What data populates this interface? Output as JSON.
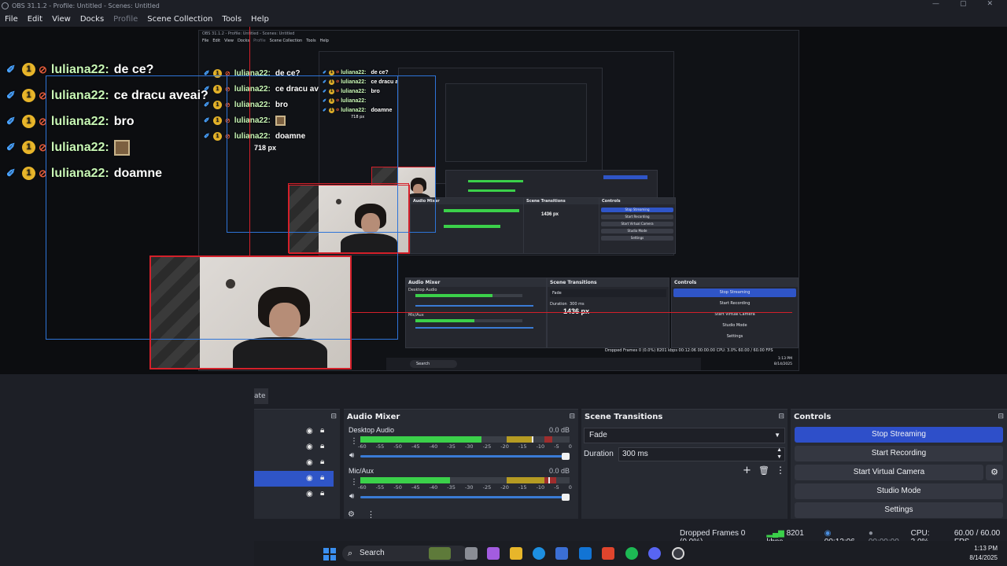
{
  "window": {
    "title": "OBS 31.1.2 - Profile: Untitled - Scenes: Untitled",
    "controls": [
      "—",
      "▢",
      "✕"
    ]
  },
  "menu": [
    "File",
    "Edit",
    "View",
    "Docks",
    "Profile",
    "Scene Collection",
    "Tools",
    "Help"
  ],
  "chat": [
    {
      "user": "luliana22:",
      "message": "de ce?"
    },
    {
      "user": "luliana22:",
      "message": "ce dracu aveai?"
    },
    {
      "user": "luliana22:",
      "message": "bro"
    },
    {
      "user": "luliana22:",
      "message": ""
    },
    {
      "user": "luliana22:",
      "message": "doamne"
    }
  ],
  "preview": {
    "label_height": "718 px",
    "label_width": "1436 px",
    "inner_title": "OBS 31.1.2 - Profile: Untitled - Scenes: Untitled",
    "inner_menu": [
      "File",
      "Edit",
      "View",
      "Docks",
      "Profile",
      "Scene Collection",
      "Tools",
      "Help"
    ],
    "inner_panels": {
      "audio": "Audio Mixer",
      "transitions": "Scene Transitions",
      "controls": "Controls"
    },
    "inner_audio": [
      "Desktop Audio",
      "Mic/Aux"
    ],
    "inner_fade": "Fade",
    "inner_duration": "Duration",
    "inner_duration_val": "300 ms",
    "inner_buttons": [
      "Stop Streaming",
      "Start Recording",
      "Start Virtual Camera",
      "Studio Mode",
      "Settings"
    ],
    "inner_status": "Dropped Frames 0 (0.0%)   8201 kbps   00:12:06   00:00:00   CPU: 3.0%   60.00 / 60.00 FPS",
    "inner_search": "Search",
    "inner_time": "1:13 PM",
    "inner_date": "8/14/2025"
  },
  "docks": {
    "scenes_tab_fragment": "ate",
    "audio_mixer": {
      "title": "Audio Mixer",
      "channels": [
        {
          "name": "Desktop Audio",
          "db": "0.0 dB",
          "level": 0.58,
          "peak": 0.82
        },
        {
          "name": "Mic/Aux",
          "db": "0.0 dB",
          "level": 0.43,
          "peak": 0.9
        }
      ],
      "ticks": [
        "-60",
        "-55",
        "-50",
        "-45",
        "-40",
        "-35",
        "-30",
        "-25",
        "-20",
        "-15",
        "-10",
        "-5",
        "0"
      ]
    },
    "scene_transitions": {
      "title": "Scene Transitions",
      "transition": "Fade",
      "duration_label": "Duration",
      "duration_value": "300 ms"
    },
    "controls": {
      "title": "Controls",
      "buttons": [
        "Stop Streaming",
        "Start Recording",
        "Start Virtual Camera",
        "Studio Mode",
        "Settings"
      ]
    }
  },
  "status": {
    "dropped": "Dropped Frames 0 (0.0%)",
    "bitrate": "8201 kbps",
    "stream_time": "00:12:06",
    "rec_time": "00:00:00",
    "cpu": "CPU: 3.0%",
    "fps": "60.00 / 60.00 FPS"
  },
  "taskbar": {
    "search": "Search",
    "time": "1:13 PM",
    "date": "8/14/2025"
  },
  "colors": {
    "accent": "#2e4fc9",
    "selection_red": "#d4202a",
    "selection_blue": "#2e74d8",
    "meter_green": "#3bd04a"
  }
}
